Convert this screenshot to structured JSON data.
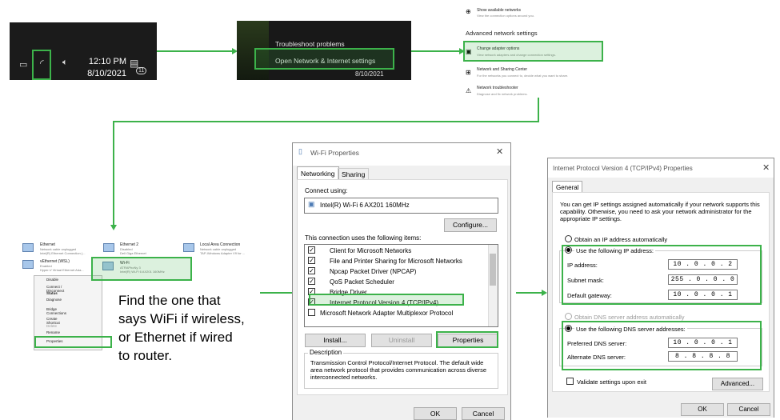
{
  "taskbar": {
    "time": "12:10 PM",
    "date": "8/10/2021",
    "badge": "11",
    "wifi_icon": "wifi-icon",
    "volume_icon": "volume-icon",
    "battery_icon": "battery-icon",
    "notification_icon": "notification-icon"
  },
  "context_menu": {
    "items": [
      "Troubleshoot problems",
      "Open Network & Internet settings"
    ],
    "date": "8/10/2021"
  },
  "network_settings": {
    "show_networks": {
      "title": "Show available networks",
      "sub": "View the connection options around you."
    },
    "section_title": "Advanced network settings",
    "items": [
      {
        "title": "Change adapter options",
        "sub": "View network adapters and change connection settings."
      },
      {
        "title": "Network and Sharing Center",
        "sub": "For the networks you connect to, decide what you want to share."
      },
      {
        "title": "Network troubleshooter",
        "sub": "Diagnose and fix network problems."
      }
    ]
  },
  "connections": {
    "adapters": [
      {
        "name": "Ethernet",
        "l1": "Network cable unplugged",
        "l2": "Intel(R) Ethernet Connection (..."
      },
      {
        "name": "Ethernet 2",
        "l1": "Disabled",
        "l2": "Dell Giga Ethernet"
      },
      {
        "name": "Local Area Connection",
        "l1": "Network cable unplugged",
        "l2": "TAP-Windows Adapter V9 for ..."
      },
      {
        "name": "vEthernet (WSL)",
        "l1": "Enabled",
        "l2": "Hyper-V Virtual Ethernet Ada..."
      },
      {
        "name": "Wi-Fi",
        "l1": "ATRAPhoNy 3",
        "l2": "Intel(R) Wi-Fi 6 AX201 160MHz"
      }
    ],
    "menu": [
      "Disable",
      "Connect / Disconnect",
      "Status",
      "Diagnose",
      "Bridge Connections",
      "Create Shortcut",
      "Delete",
      "Rename",
      "Properties"
    ]
  },
  "instruction": "Find the one that says WiFi if wireless, or Ethernet if wired to router.",
  "instruction_lines": [
    "Find the one that",
    "says WiFi if wireless,",
    "or Ethernet if wired",
    "to router."
  ],
  "wifi_props": {
    "title": "Wi-Fi Properties",
    "tabs": [
      "Networking",
      "Sharing"
    ],
    "connect_using_label": "Connect using:",
    "adapter": "Intel(R) Wi-Fi 6 AX201 160MHz",
    "configure": "Configure...",
    "items_label": "This connection uses the following items:",
    "items": [
      {
        "label": "Client for Microsoft Networks",
        "checked": true
      },
      {
        "label": "File and Printer Sharing for Microsoft Networks",
        "checked": true
      },
      {
        "label": "Npcap Packet Driver (NPCAP)",
        "checked": true
      },
      {
        "label": "QoS Packet Scheduler",
        "checked": true
      },
      {
        "label": "Bridge Driver",
        "checked": true
      },
      {
        "label": "Internet Protocol Version 4 (TCP/IPv4)",
        "checked": true
      },
      {
        "label": "Microsoft Network Adapter Multiplexor Protocol",
        "checked": false
      }
    ],
    "install": "Install...",
    "uninstall": "Uninstall",
    "properties": "Properties",
    "description_label": "Description",
    "description": "Transmission Control Protocol/Internet Protocol. The default wide area network protocol that provides communication across diverse interconnected networks.",
    "ok": "OK",
    "cancel": "Cancel"
  },
  "ipv4_props": {
    "title": "Internet Protocol Version 4 (TCP/IPv4) Properties",
    "tab": "General",
    "intro": "You can get IP settings assigned automatically if your network supports this capability. Otherwise, you need to ask your network administrator for the appropriate IP settings.",
    "auto_ip": "Obtain an IP address automatically",
    "use_ip": "Use the following IP address:",
    "ip_label": "IP address:",
    "ip": "10 . 0 . 0 . 2",
    "mask_label": "Subnet mask:",
    "mask": "255 . 0 . 0 . 0",
    "gw_label": "Default gateway:",
    "gw": "10 . 0 . 0 . 1",
    "auto_dns": "Obtain DNS server address automatically",
    "use_dns": "Use the following DNS server addresses:",
    "pref_label": "Preferred DNS server:",
    "pref": "10 . 0 . 0 . 1",
    "alt_label": "Alternate DNS server:",
    "alt": "8 . 8 . 8 . 8",
    "validate": "Validate settings upon exit",
    "advanced": "Advanced...",
    "ok": "OK",
    "cancel": "Cancel"
  },
  "colors": {
    "accent": "#3cb24a"
  }
}
